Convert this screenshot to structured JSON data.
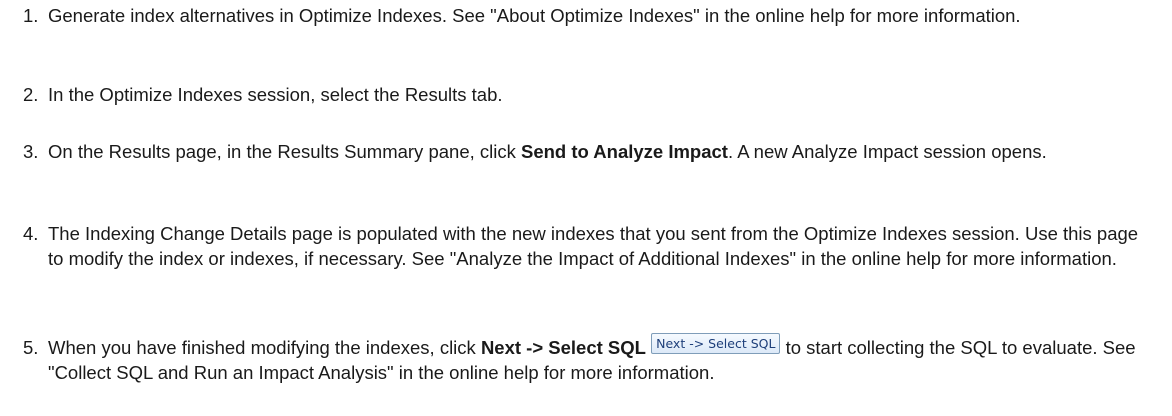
{
  "steps": [
    {
      "number": "1.",
      "text": "Generate index alternatives in Optimize Indexes. See \"About Optimize Indexes\" in the online help for more information."
    },
    {
      "number": "2.",
      "text": "In the Optimize Indexes session, select the Results tab."
    },
    {
      "number": "3.",
      "text_before": "On the Results page, in the Results Summary pane, click ",
      "bold": "Send to Analyze Impact",
      "text_after": ". A new Analyze Impact session opens."
    },
    {
      "number": "4.",
      "text": "The Indexing Change Details page is populated with the new indexes that you sent from the Optimize Indexes session. Use this page to modify the index or indexes, if necessary. See \"Analyze the Impact of Additional Indexes\" in the online help for more information."
    },
    {
      "number": "5.",
      "text_before": "When you have finished modifying the indexes, click ",
      "bold": "Next -> Select SQL",
      "button_label": "Next -> Select SQL",
      "text_after": " to start collecting the SQL to evaluate. See \"Collect SQL and Run an Impact Analysis\" in the online help for more information."
    }
  ]
}
